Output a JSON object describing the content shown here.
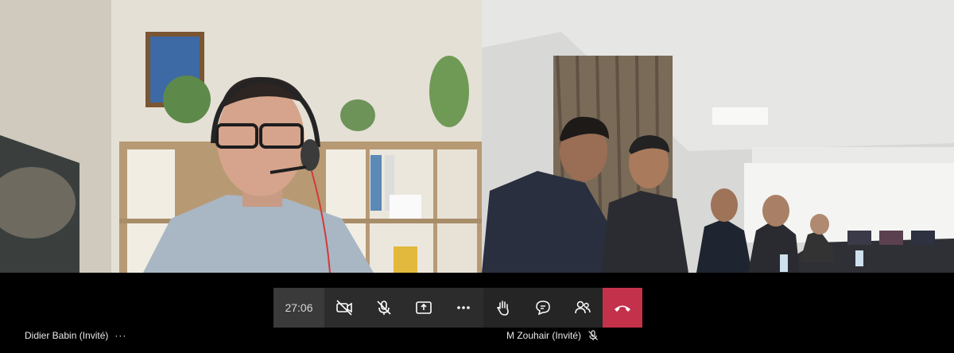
{
  "call": {
    "timer": "27:06",
    "colors": {
      "hangup": "#c4314b",
      "bar": "#2d2c2c",
      "background": "#000000"
    }
  },
  "participants": [
    {
      "name": "Didier Babin (Invité)",
      "more": "···"
    },
    {
      "name": "M Zouhair (Invité)",
      "mic_icon": "mic-muted-icon"
    }
  ],
  "toolbar": {
    "icons": [
      "camera-off-icon",
      "mic-off-icon",
      "share-screen-icon",
      "more-icon",
      "raise-hand-icon",
      "chat-icon",
      "participants-icon",
      "hangup-icon"
    ]
  }
}
